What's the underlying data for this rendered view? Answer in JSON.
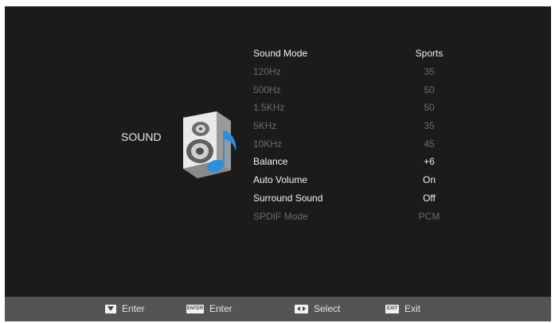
{
  "section": {
    "title": "SOUND"
  },
  "menu": {
    "items": [
      {
        "label": "Sound Mode",
        "value": "Sports",
        "state": "active"
      },
      {
        "label": "120Hz",
        "value": "35",
        "state": "dim"
      },
      {
        "label": "500Hz",
        "value": "50",
        "state": "dim"
      },
      {
        "label": "1.5KHz",
        "value": "50",
        "state": "dim"
      },
      {
        "label": "5KHz",
        "value": "35",
        "state": "dim"
      },
      {
        "label": "10KHz",
        "value": "45",
        "state": "dim"
      },
      {
        "label": "Balance",
        "value": "+6",
        "state": "active"
      },
      {
        "label": "Auto Volume",
        "value": "On",
        "state": "active"
      },
      {
        "label": "Surround Sound",
        "value": "Off",
        "state": "active"
      },
      {
        "label": "SPDIF Mode",
        "value": "PCM",
        "state": "dim"
      }
    ]
  },
  "footer": {
    "hints": [
      {
        "key_icon": "down-arrow-key-icon",
        "key_text": "",
        "label": "Enter"
      },
      {
        "key_icon": "enter-key-icon",
        "key_text": "ENTER",
        "label": "Enter"
      },
      {
        "key_icon": "left-right-arrow-key-icon",
        "key_text": "",
        "label": "Select"
      },
      {
        "key_icon": "exit-key-icon",
        "key_text": "EXIT",
        "label": "Exit"
      }
    ]
  },
  "colors": {
    "background": "#1b1b1b",
    "footer": "#545454",
    "active_text": "#f1f1f1",
    "dim_text": "#6b6b6b",
    "music_note": "#2a8fe0"
  }
}
